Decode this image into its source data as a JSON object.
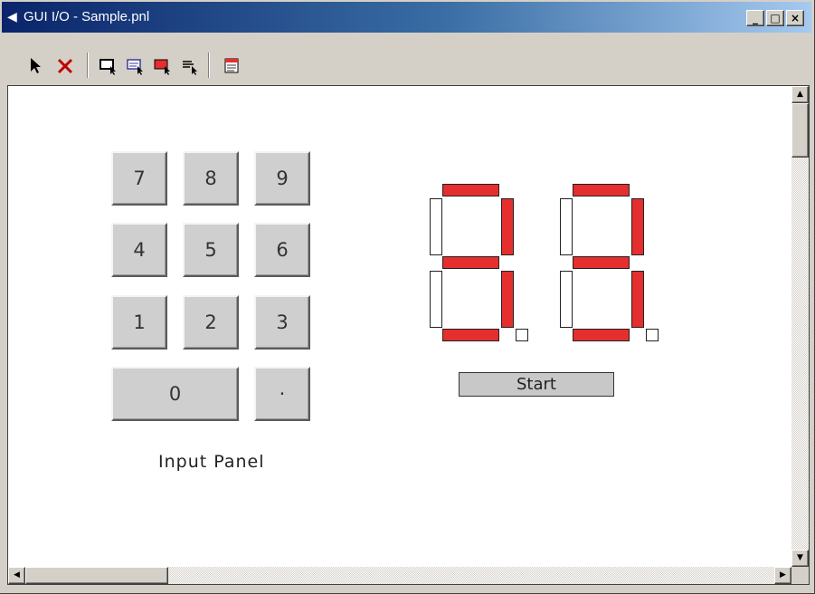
{
  "window": {
    "title": "GUI I/O - Sample.pnl",
    "title_icon": "gui-io-icon",
    "controls": [
      "_",
      "□",
      "×"
    ]
  },
  "toolbar": {
    "tools": [
      "select-arrow-icon",
      "delete-x-icon",
      "insert-button-icon",
      "insert-label-icon",
      "insert-lamp-icon",
      "insert-text-icon",
      "panel-settings-icon"
    ]
  },
  "input_panel": {
    "keys": [
      "7",
      "8",
      "9",
      "4",
      "5",
      "6",
      "1",
      "2",
      "3"
    ],
    "zero": "0",
    "dot": "·",
    "label": "Input Panel"
  },
  "display": {
    "digits": [
      {
        "a": true,
        "b": true,
        "c": true,
        "d": true,
        "e": false,
        "f": false,
        "g": true,
        "dp": false
      },
      {
        "a": true,
        "b": true,
        "c": true,
        "d": true,
        "e": false,
        "f": false,
        "g": true,
        "dp": false
      }
    ],
    "on_color": "#e52e2e",
    "off_color": "#ffffff"
  },
  "start_button": {
    "label": "Start"
  },
  "colors": {
    "titlebar_start": "#0a246a",
    "titlebar_end": "#a6caf0",
    "segment_on": "#e52e2e"
  }
}
